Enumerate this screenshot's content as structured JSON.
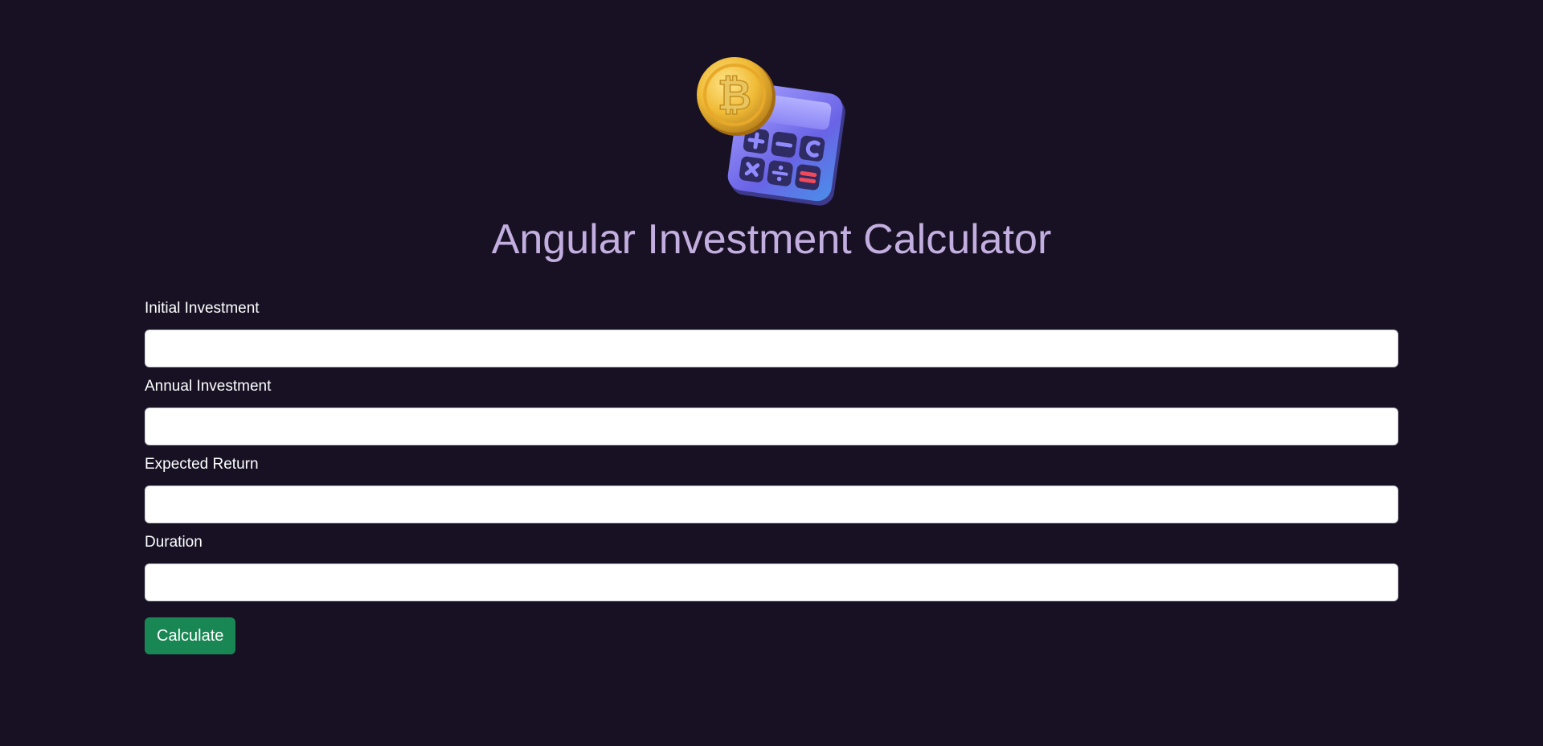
{
  "header": {
    "title": "Angular Investment Calculator",
    "logo_icon": "bitcoin-calculator-icon"
  },
  "form": {
    "fields": [
      {
        "label": "Initial Investment",
        "value": ""
      },
      {
        "label": "Annual Investment",
        "value": ""
      },
      {
        "label": "Expected Return",
        "value": ""
      },
      {
        "label": "Duration",
        "value": ""
      }
    ],
    "submit_label": "Calculate"
  },
  "colors": {
    "background": "#181124",
    "title": "#c3aee0",
    "button": "#198754"
  }
}
